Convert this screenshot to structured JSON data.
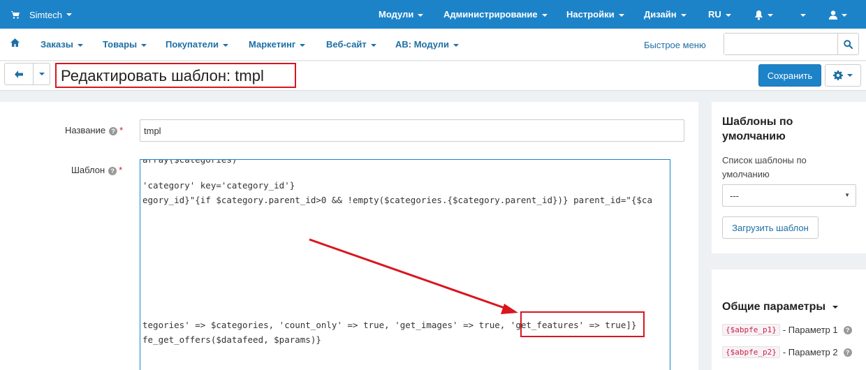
{
  "topbar": {
    "brand": "Simtech",
    "menus": [
      "Модули",
      "Администрирование",
      "Настройки",
      "Дизайн",
      "RU"
    ]
  },
  "nav": {
    "items": [
      "Заказы",
      "Товары",
      "Покупатели",
      "Маркетинг",
      "Веб-сайт",
      "AB: Модули"
    ],
    "quick_menu": "Быстрое меню",
    "search_placeholder": ""
  },
  "titlebar": {
    "title": "Редактировать шаблон: tmpl",
    "save_label": "Сохранить"
  },
  "form": {
    "name_label": "Название",
    "name_value": "tmpl",
    "template_label": "Шаблон",
    "help_glyph": "?",
    "required_mark": "*",
    "code_lines": [
      "array($categories)",
      "'category' key='category_id'}",
      "egory_id}\"{if $category.parent_id>0 && !empty($categories.{$category.parent_id})} parent_id=\"{$ca",
      "tegories' => $categories, 'count_only' => true, 'get_images' => true, 'get_features' => true]}",
      "fe_get_offers($datafeed, $params)}"
    ]
  },
  "sidebar": {
    "defaults_title": "Шаблоны по умолчанию",
    "defaults_list_label": "Список шаблоны по умолчанию",
    "select_value": "---",
    "load_button": "Загрузить шаблон",
    "params_title": "Общие параметры",
    "params": [
      {
        "code": "{$abpfe_p1}",
        "label": "- Параметр 1"
      },
      {
        "code": "{$abpfe_p2}",
        "label": "- Параметр 2"
      }
    ]
  },
  "colors": {
    "primary": "#1d83c8",
    "highlight": "#d9151e"
  }
}
